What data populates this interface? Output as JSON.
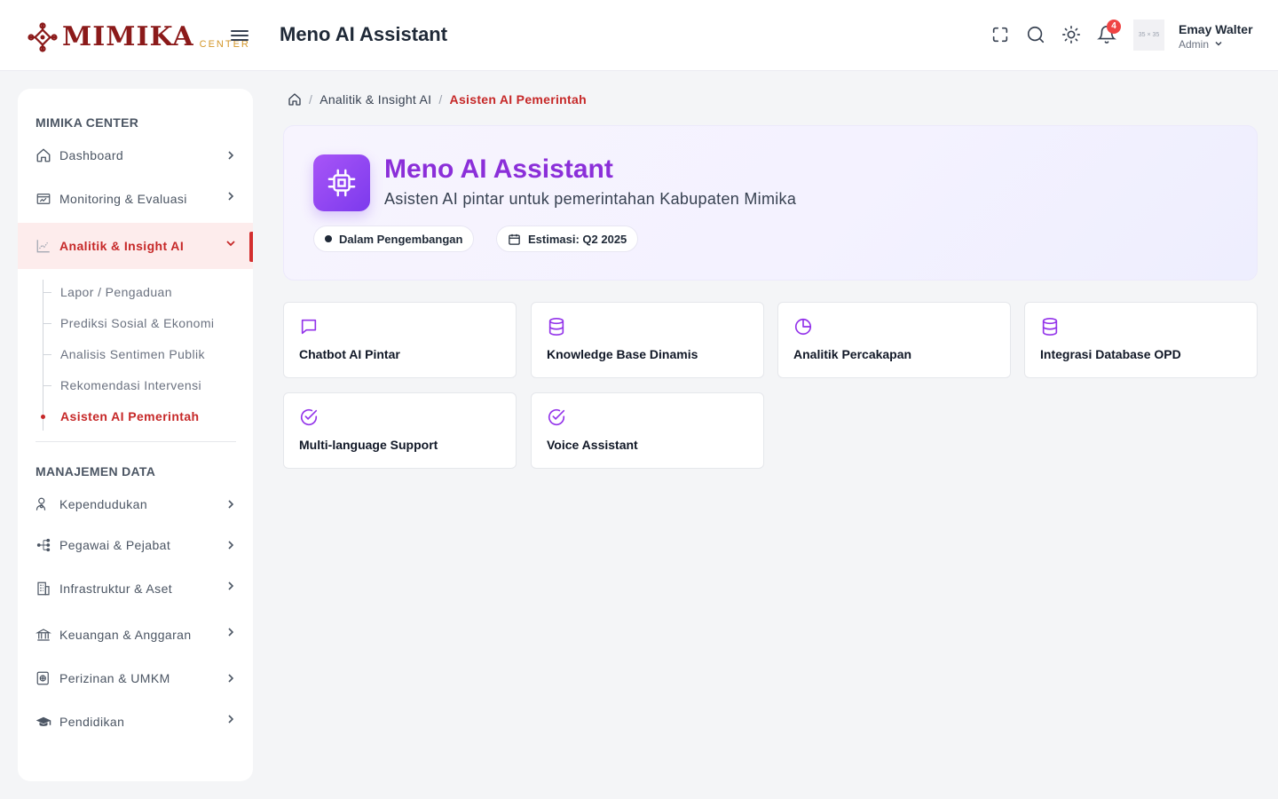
{
  "header": {
    "logo_word": "MIMIKA",
    "logo_sub": "CENTER",
    "page_title": "Meno AI Assistant",
    "notification_count": "4",
    "avatar_placeholder": "35 × 35",
    "user_name": "Emay Walter",
    "user_role": "Admin"
  },
  "sidebar": {
    "section1_title": "MIMIKA CENTER",
    "section2_title": "MANAJEMEN DATA",
    "items": [
      {
        "label": "Dashboard"
      },
      {
        "label": "Monitoring & Evaluasi"
      },
      {
        "label": "Analitik & Insight AI"
      },
      {
        "label": "Kependudukan"
      },
      {
        "label": "Pegawai & Pejabat"
      },
      {
        "label": "Infrastruktur & Aset"
      },
      {
        "label": "Keuangan & Anggaran"
      },
      {
        "label": "Perizinan & UMKM"
      },
      {
        "label": "Pendidikan"
      }
    ],
    "subitems": [
      {
        "label": "Lapor / Pengaduan"
      },
      {
        "label": "Prediksi Sosial & Ekonomi"
      },
      {
        "label": "Analisis Sentimen Publik"
      },
      {
        "label": "Rekomendasi Intervensi"
      },
      {
        "label": "Asisten AI Pemerintah"
      }
    ]
  },
  "breadcrumb": {
    "parent": "Analitik & Insight AI",
    "current": "Asisten AI Pemerintah"
  },
  "hero": {
    "title": "Meno AI Assistant",
    "subtitle": "Asisten AI pintar untuk pemerintahan Kabupaten Mimika",
    "status": "Dalam Pengembangan",
    "estimate": "Estimasi: Q2 2025"
  },
  "features": [
    {
      "label": "Chatbot AI Pintar",
      "icon": "message-square-icon"
    },
    {
      "label": "Knowledge Base Dinamis",
      "icon": "database-icon"
    },
    {
      "label": "Analitik Percakapan",
      "icon": "pie-chart-icon"
    },
    {
      "label": "Integrasi Database OPD",
      "icon": "database-icon"
    },
    {
      "label": "Multi-language Support",
      "icon": "check-circle-icon"
    },
    {
      "label": "Voice Assistant",
      "icon": "check-circle-icon"
    }
  ],
  "colors": {
    "brand": "#8b1a1a",
    "accent_red": "#c62828",
    "accent_purple": "#8b2fd9",
    "icon_purple": "#9333ea"
  }
}
